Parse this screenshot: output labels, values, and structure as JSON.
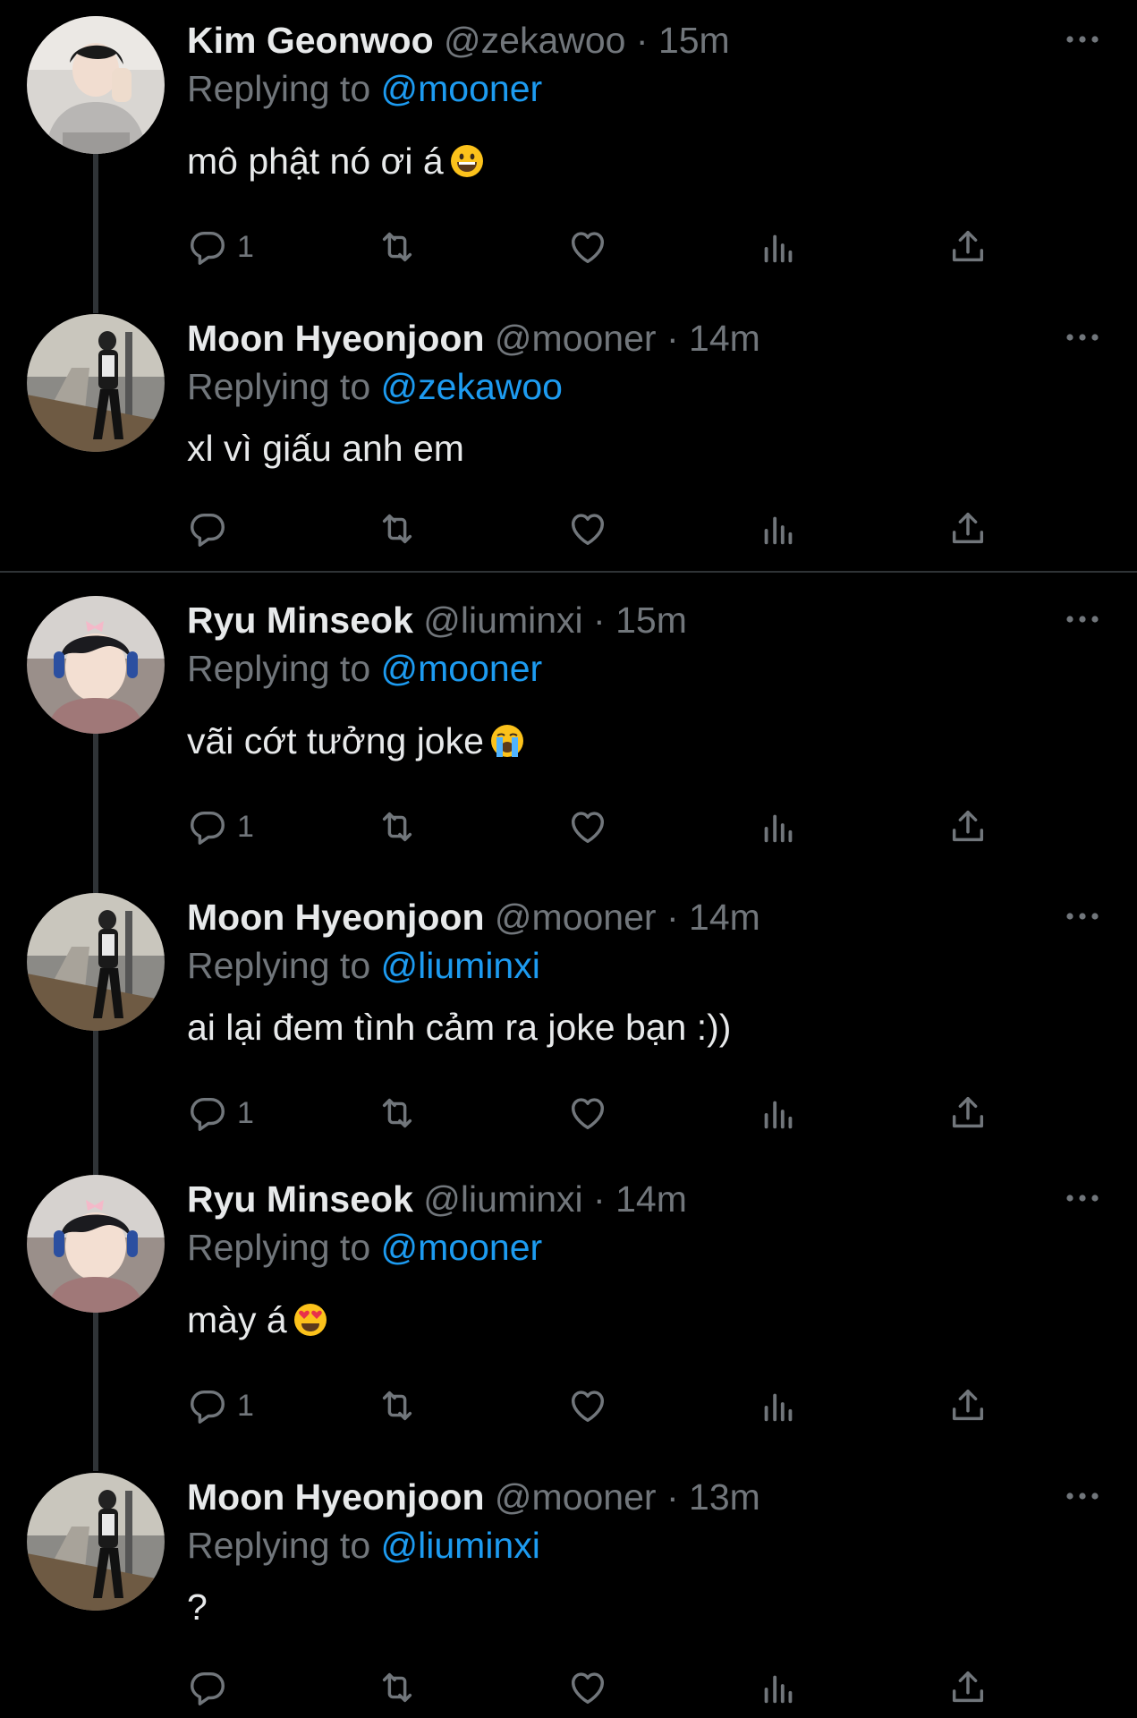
{
  "colors": {
    "background": "#000000",
    "text": "#e7e9ea",
    "muted": "#71767b",
    "link": "#1d9bf0",
    "line": "#2f3336"
  },
  "icons": {
    "more": "more-horizontal-icon",
    "reply": "reply-icon",
    "retweet": "retweet-icon",
    "like": "like-icon",
    "views": "views-icon",
    "share": "share-icon"
  },
  "tweets": [
    {
      "name": "Kim Geonwoo",
      "handle": "@zekawoo",
      "sep": "·",
      "time": "15m",
      "replying_prefix": "Replying to",
      "replying_to": "@mooner",
      "text": "mô phật nó ơi á",
      "emoji": "grinning-face",
      "reply_count": "1"
    },
    {
      "name": "Moon Hyeonjoon",
      "handle": "@mooner",
      "sep": "·",
      "time": "14m",
      "replying_prefix": "Replying to",
      "replying_to": "@zekawoo",
      "text": "xl vì giấu anh em",
      "reply_count": ""
    },
    {
      "name": "Ryu Minseok",
      "handle": "@liuminxi",
      "sep": "·",
      "time": "15m",
      "replying_prefix": "Replying to",
      "replying_to": "@mooner",
      "text": "vãi cớt tưởng joke",
      "emoji": "crying-face",
      "reply_count": "1"
    },
    {
      "name": "Moon Hyeonjoon",
      "handle": "@mooner",
      "sep": "·",
      "time": "14m",
      "replying_prefix": "Replying to",
      "replying_to": "@liuminxi",
      "text": "ai lại đem tình cảm ra joke bạn :))",
      "reply_count": "1"
    },
    {
      "name": "Ryu Minseok",
      "handle": "@liuminxi",
      "sep": "·",
      "time": "14m",
      "replying_prefix": "Replying to",
      "replying_to": "@mooner",
      "text": "mày á",
      "emoji": "heart-eyes-face",
      "reply_count": "1"
    },
    {
      "name": "Moon Hyeonjoon",
      "handle": "@mooner",
      "sep": "·",
      "time": "13m",
      "replying_prefix": "Replying to",
      "replying_to": "@liuminxi",
      "text": "?",
      "reply_count": ""
    }
  ]
}
